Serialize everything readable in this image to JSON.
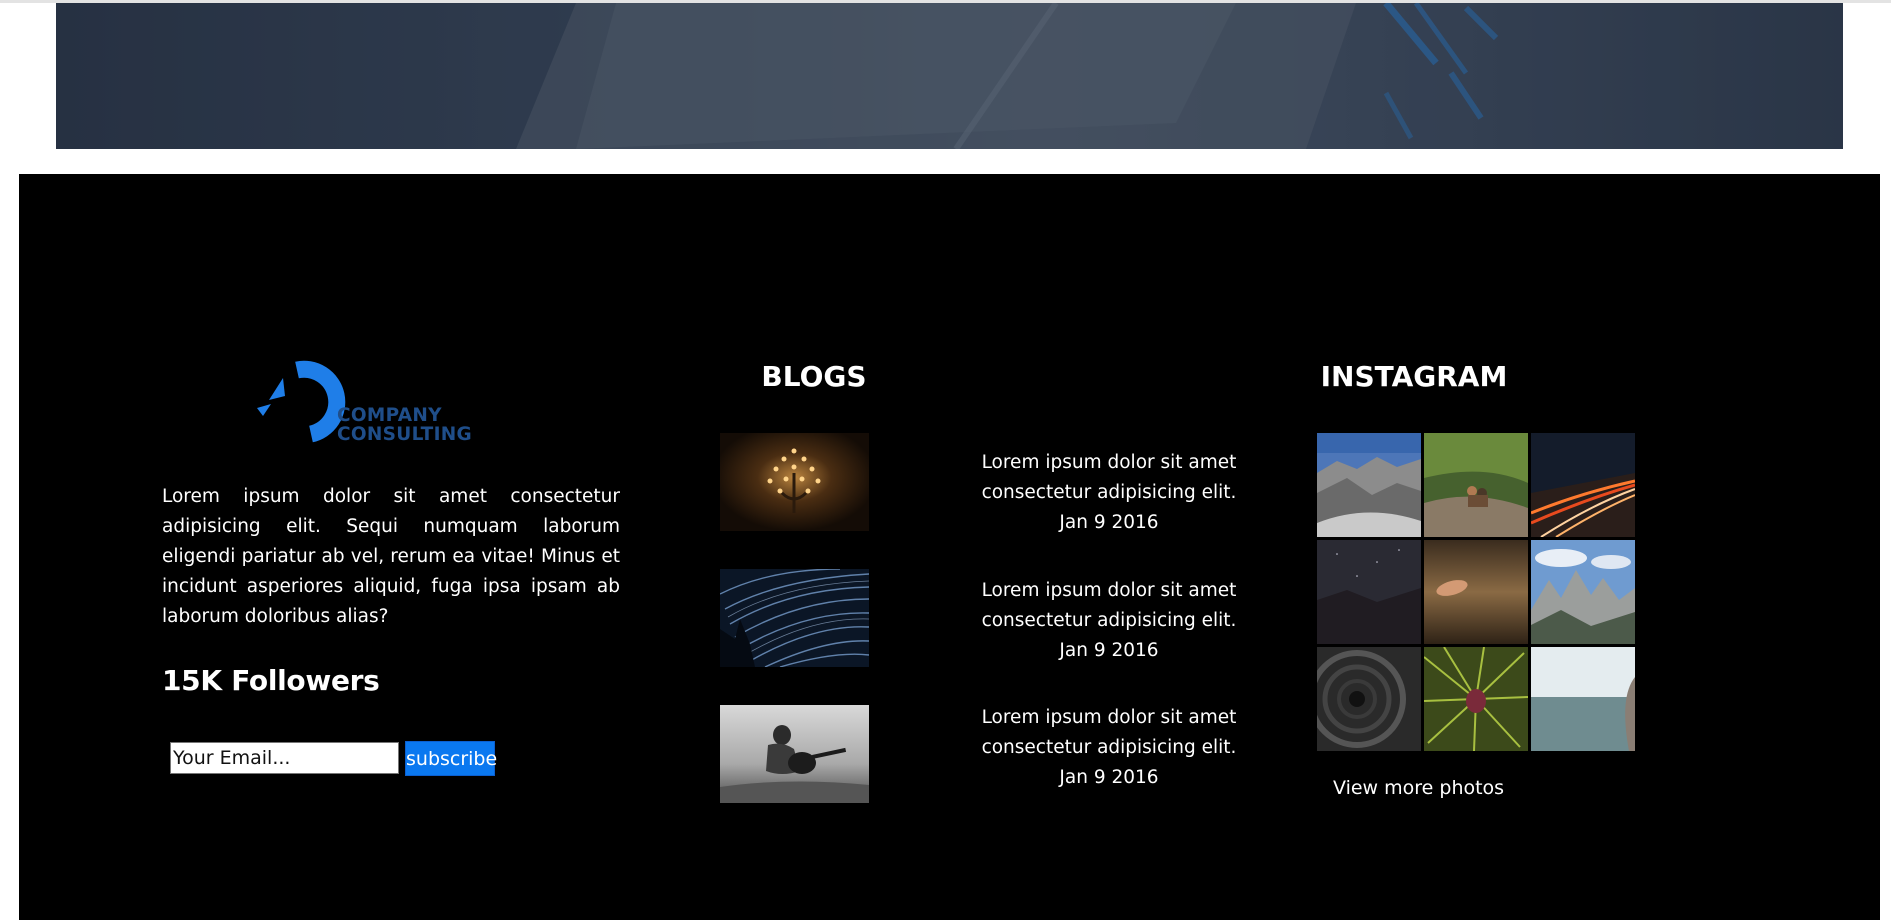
{
  "hero": {
    "image": "consulting-documents-photo"
  },
  "about": {
    "logo_line1": "COMPANY",
    "logo_line2": "CONSULTING",
    "logo_icon": "company-logo-icon",
    "description": "Lorem ipsum dolor sit amet consectetur adipisicing elit. Sequi numquam laborum eligendi pariatur ab vel, rerum ea vitae! Minus et incidunt asperiores aliquid, fuga ipsa ipsam ab laborum doloribus alias?",
    "followers": "15K Followers",
    "email_placeholder": "Your Email...",
    "subscribe_label": "subscribe"
  },
  "blogs": {
    "heading": "BLOGS",
    "posts": [
      {
        "thumb": "chandelier-photo",
        "line1": "Lorem ipsum dolor sit amet",
        "line2": "consectetur adipisicing elit.",
        "date": "Jan 9 2016"
      },
      {
        "thumb": "star-trails-photo",
        "line1": "Lorem ipsum dolor sit amet",
        "line2": "consectetur adipisicing elit.",
        "date": "Jan 9 2016"
      },
      {
        "thumb": "guitar-player-photo",
        "line1": "Lorem ipsum dolor sit amet",
        "line2": "consectetur adipisicing elit.",
        "date": "Jan 9 2016"
      }
    ]
  },
  "instagram": {
    "heading": "INSTAGRAM",
    "photos": [
      "mountain-valley-photo",
      "hikers-cliff-photo",
      "night-highway-photo",
      "night-sky-photo",
      "beach-hand-photo",
      "rocky-peaks-photo",
      "tunnel-photo",
      "pine-cone-photo",
      "sea-horizon-photo"
    ],
    "view_more": "View more photos"
  },
  "colors": {
    "footer_bg": "#000000",
    "accent": "#0a78f0",
    "logo_blue": "#1f7ee8",
    "logo_text": "#1f4e8a"
  }
}
